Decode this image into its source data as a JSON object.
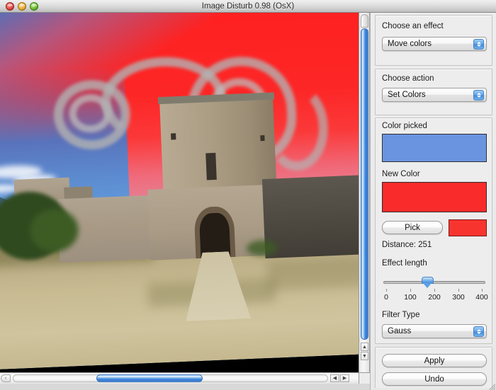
{
  "window": {
    "title": "Image Disturb 0.98 (OsX)",
    "traffic_lights": [
      "close",
      "minimize",
      "zoom"
    ]
  },
  "canvas": {
    "description": "Rotated photograph of a stone castle gatehouse with a red-tinted sky and grey spray-painted graffiti swirls",
    "background": "#000000"
  },
  "panel": {
    "effect_group": {
      "label": "Choose an effect",
      "selected": "Move colors",
      "options": [
        "Move colors"
      ]
    },
    "action_group": {
      "label": "Choose action",
      "selected": "Set Colors",
      "options": [
        "Set Colors"
      ]
    },
    "color_group": {
      "picked_label": "Color picked",
      "picked_color": "#6b94e0",
      "new_label": "New Color",
      "new_color": "#fa2b2b",
      "pick_button": "Pick",
      "preview_color": "#f8342f",
      "distance_label": "Distance: 251"
    },
    "effect_length": {
      "label": "Effect length",
      "value": 200,
      "min": 0,
      "max": 400,
      "ticks": [
        "0",
        "100",
        "200",
        "300",
        "400"
      ]
    },
    "filter_group": {
      "label": "Filter Type",
      "selected": "Gauss",
      "options": [
        "Gauss"
      ]
    },
    "actions": {
      "apply": "Apply",
      "undo": "Undo"
    }
  },
  "scrollbars": {
    "vertical_position": "top",
    "horizontal_position": "center",
    "up_arrow": "▲",
    "down_arrow": "▼",
    "left_arrow": "◀",
    "right_arrow": "▶"
  }
}
